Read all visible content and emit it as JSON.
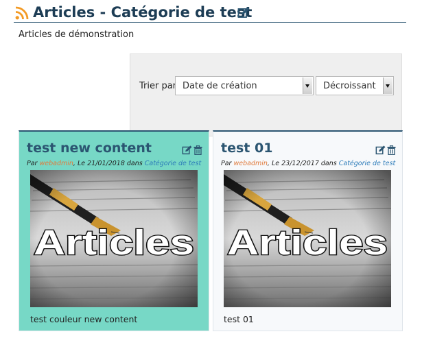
{
  "page": {
    "title": "Articles - Catégorie de test",
    "description": "Articles de démonstration",
    "icons": {
      "feed": "rss-feed-icon",
      "edit": "edit-icon"
    }
  },
  "sort": {
    "label": "Trier par",
    "field_value": "Date de création",
    "order_value": "Décroissant"
  },
  "articles": [
    {
      "title": "test new content",
      "meta_by": "Par",
      "author": "webadmin",
      "meta_date": ", Le 21/01/2018 dans",
      "category": "Catégorie de test",
      "image_word": "Articles",
      "text": "test couleur new content",
      "background": "#77d8c6"
    },
    {
      "title": "test 01",
      "meta_by": "Par",
      "author": "webadmin",
      "meta_date": ", Le 23/12/2017 dans",
      "category": "Catégorie de test",
      "image_word": "Articles",
      "text": "test 01",
      "background": "#f7f9fb"
    }
  ],
  "colors": {
    "heading": "#1d3d55",
    "accent": "#2b5571",
    "author_link": "#e07a3b",
    "category_link": "#2b7ab8",
    "rss": "#f39a24"
  }
}
